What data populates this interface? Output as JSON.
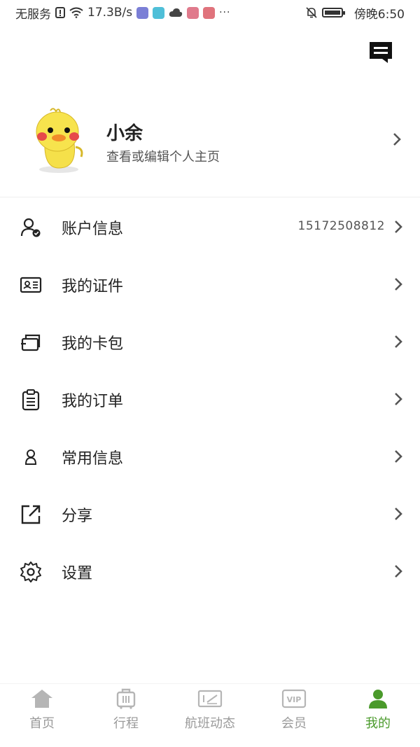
{
  "status_bar": {
    "carrier": "无服务",
    "speed": "17.3B/s",
    "time": "傍晚6:50"
  },
  "profile": {
    "name": "小余",
    "subtitle": "查看或编辑个人主页"
  },
  "menu": [
    {
      "label": "账户信息",
      "value": "15172508812",
      "icon": "user-check-icon"
    },
    {
      "label": "我的证件",
      "value": "",
      "icon": "id-card-icon"
    },
    {
      "label": "我的卡包",
      "value": "",
      "icon": "card-wallet-icon"
    },
    {
      "label": "我的订单",
      "value": "",
      "icon": "clipboard-icon"
    },
    {
      "label": "常用信息",
      "value": "",
      "icon": "contact-icon"
    },
    {
      "label": "分享",
      "value": "",
      "icon": "share-icon"
    },
    {
      "label": "设置",
      "value": "",
      "icon": "settings-icon"
    }
  ],
  "tabs": [
    {
      "label": "首页",
      "icon": "home-icon",
      "active": false
    },
    {
      "label": "行程",
      "icon": "luggage-icon",
      "active": false
    },
    {
      "label": "航班动态",
      "icon": "flight-board-icon",
      "active": false
    },
    {
      "label": "会员",
      "icon": "vip-icon",
      "active": false
    },
    {
      "label": "我的",
      "icon": "person-icon",
      "active": true
    }
  ],
  "colors": {
    "accent": "#4a9a2b",
    "inactive": "#9a9a9a",
    "text": "#222222"
  }
}
